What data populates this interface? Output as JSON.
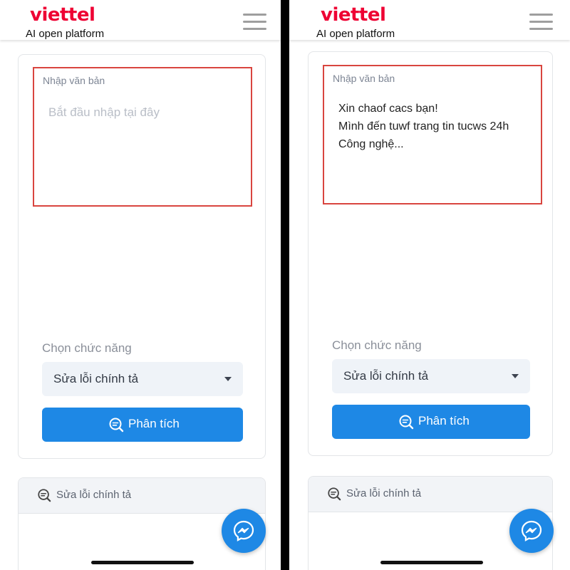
{
  "brand": {
    "name": "viettel",
    "tagline": "AI open platform",
    "accent": "#ee0033",
    "button_color": "#1e88e5"
  },
  "left": {
    "text_label": "Nhập văn bản",
    "text_placeholder": "Bắt đầu nhập tại đây",
    "function_label": "Chọn chức năng",
    "function_selected": "Sửa lỗi chính tả",
    "analyze_label": "Phân tích",
    "result_title": "Sửa lỗi chính tả"
  },
  "right": {
    "text_label": "Nhập văn bản",
    "text_lines": [
      "Xin chaof cacs bạn!",
      "Mình đến tuwf trang tin tucws 24h",
      "Công nghệ..."
    ],
    "function_label": "Chọn chức năng",
    "function_selected": "Sửa lỗi chính tả",
    "analyze_label": "Phân tích",
    "result_title": "Sửa lỗi chính tả"
  },
  "icons": [
    "hamburger-menu-icon",
    "analyze-search-icon",
    "chevron-down-icon",
    "messenger-icon"
  ]
}
